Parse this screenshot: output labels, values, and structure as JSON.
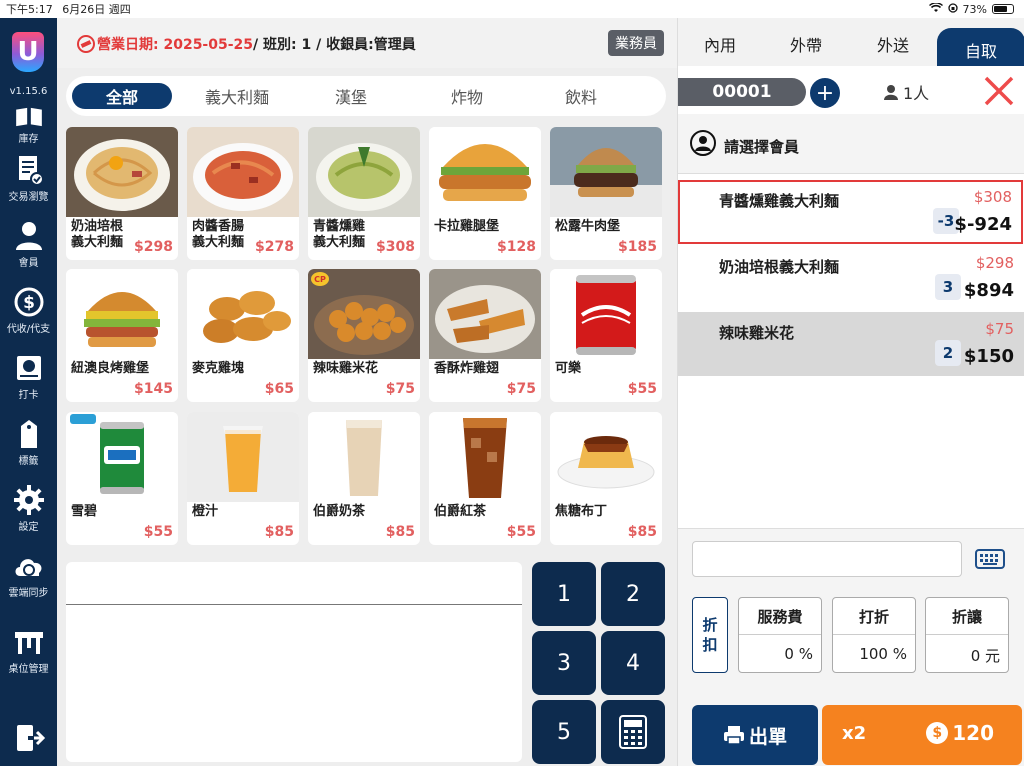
{
  "status": {
    "time": "下午5:17",
    "date": "6月26日 週四",
    "battery": "73%",
    "battery_level": 0.73
  },
  "sidebar": {
    "version": "v1.15.6",
    "items": [
      {
        "label": "庫存",
        "icon": "inventory-icon"
      },
      {
        "label": "交易瀏覽",
        "icon": "transactions-icon"
      },
      {
        "label": "會員",
        "icon": "member-icon"
      },
      {
        "label": "代收/代支",
        "icon": "cash-icon"
      },
      {
        "label": "打卡",
        "icon": "clock-in-icon"
      },
      {
        "label": "標籤",
        "icon": "label-icon"
      },
      {
        "label": "設定",
        "icon": "gear-icon"
      },
      {
        "label": "雲端同步",
        "icon": "cloud-sync-icon"
      },
      {
        "label": "桌位管理",
        "icon": "table-icon"
      }
    ],
    "logout_icon": "logout-icon"
  },
  "header": {
    "date_label": "營業日期: 2025-05-25",
    "shift_info": " / 班別: 1 / 收銀員:管理員",
    "staff_button": "業務員"
  },
  "categories": [
    {
      "label": "全部",
      "active": true
    },
    {
      "label": "義大利麵",
      "active": false
    },
    {
      "label": "漢堡",
      "active": false
    },
    {
      "label": "炸物",
      "active": false
    },
    {
      "label": "飲料",
      "active": false
    }
  ],
  "products": [
    {
      "name": "奶油培根\n義大利麵",
      "price": "$298"
    },
    {
      "name": "肉醬香腸\n義大利麵",
      "price": "$278"
    },
    {
      "name": "青醬燻雞\n義大利麵",
      "price": "$308"
    },
    {
      "name": "卡拉雞腿堡",
      "price": "$128"
    },
    {
      "name": "松露牛肉堡",
      "price": "$185"
    },
    {
      "name": "紐澳良烤雞堡",
      "price": "$145"
    },
    {
      "name": "麥克雞塊",
      "price": "$65"
    },
    {
      "name": "辣味雞米花",
      "price": "$75"
    },
    {
      "name": "香酥炸雞翅",
      "price": "$75"
    },
    {
      "name": "可樂",
      "price": "$55"
    },
    {
      "name": "雪碧",
      "price": "$55"
    },
    {
      "name": "橙汁",
      "price": "$85"
    },
    {
      "name": "伯爵奶茶",
      "price": "$85"
    },
    {
      "name": "伯爵紅茶",
      "price": "$55"
    },
    {
      "name": "焦糖布丁",
      "price": "$85"
    }
  ],
  "keypad": [
    "1",
    "2",
    "3",
    "4",
    "5"
  ],
  "order": {
    "tabs": [
      {
        "label": "內用",
        "active": false
      },
      {
        "label": "外帶",
        "active": false
      },
      {
        "label": "外送",
        "active": false
      },
      {
        "label": "自取",
        "active": true
      }
    ],
    "order_no": "00001",
    "people": "1人",
    "member_label": "請選擇會員",
    "items": [
      {
        "name": "青醬燻雞義大利麵",
        "unit_price": "$308",
        "qty": "-3",
        "subtotal": "$-924"
      },
      {
        "name": "奶油培根義大利麵",
        "unit_price": "$298",
        "qty": "3",
        "subtotal": "$894"
      },
      {
        "name": "辣味雞米花",
        "unit_price": "$75",
        "qty": "2",
        "subtotal": "$150"
      }
    ],
    "discount_label": "折\n扣",
    "service_fee": {
      "title": "服務費",
      "value": "0 %"
    },
    "discount": {
      "title": "打折",
      "value": "100 %"
    },
    "allowance": {
      "title": "折讓",
      "value": "0 元"
    },
    "print_label": "出單",
    "pay_count": "x2",
    "pay_amount": "120"
  },
  "colors": {
    "navy": "#0d2b4e",
    "accent": "#0d3a6e",
    "price_red": "#e26060",
    "orange": "#f5821f"
  }
}
